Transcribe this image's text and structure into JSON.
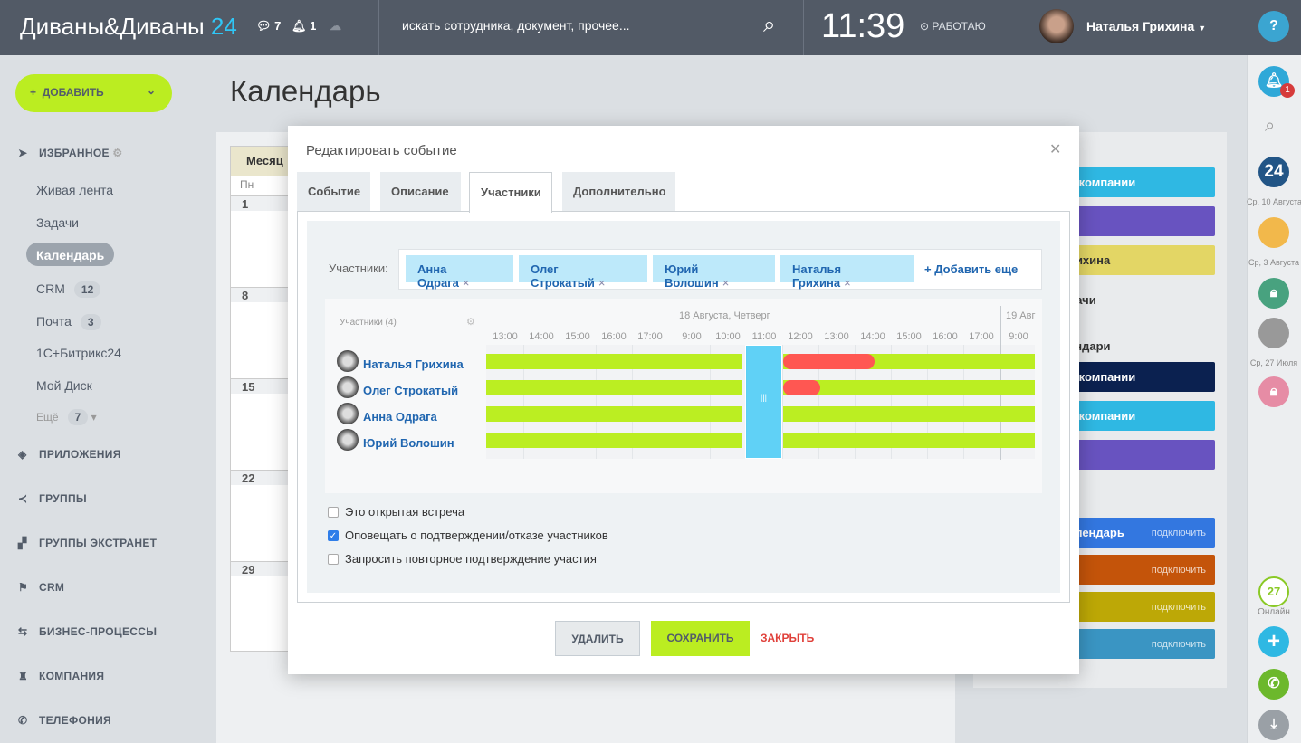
{
  "header": {
    "logo": "Диваны&Диваны",
    "logo_suffix": "24",
    "chat_count": "7",
    "notif_count": "1",
    "search_placeholder": "искать сотрудника, документ, прочее...",
    "clock": "11:39",
    "work_status": "РАБОТАЮ",
    "user_name": "Наталья Грихина"
  },
  "add_button": "ДОБАВИТЬ",
  "page_title": "Календарь",
  "sidebar": {
    "favorites": "ИЗБРАННОЕ",
    "items": [
      {
        "label": "Живая лента"
      },
      {
        "label": "Задачи"
      },
      {
        "label": "Календарь",
        "active": true
      },
      {
        "label": "CRM",
        "badge": "12"
      },
      {
        "label": "Почта",
        "badge": "3"
      },
      {
        "label": "1С+Битрикс24"
      },
      {
        "label": "Мой Диск"
      }
    ],
    "more": "Ещё",
    "more_count": "7",
    "sections": [
      {
        "label": "ПРИЛОЖЕНИЯ",
        "icon": "cube-icon"
      },
      {
        "label": "ГРУППЫ",
        "icon": "share-icon"
      },
      {
        "label": "ГРУППЫ ЭКСТРАНЕТ",
        "icon": "structure-icon"
      },
      {
        "label": "CRM",
        "icon": "flag-icon"
      },
      {
        "label": "БИЗНЕС-ПРОЦЕССЫ",
        "icon": "process-icon"
      },
      {
        "label": "КОМПАНИЯ",
        "icon": "tower-icon"
      },
      {
        "label": "ТЕЛЕФОНИЯ",
        "icon": "phone-icon"
      }
    ]
  },
  "calendar": {
    "view_tab": "Месяц",
    "weekday": "Пн",
    "weeks": [
      "1",
      "8",
      "15",
      "22",
      "29"
    ]
  },
  "right_panel": {
    "bars": [
      {
        "text": "ь компании",
        "color": "#2fb8e3"
      },
      {
        "text": "",
        "color": "#6853c0"
      },
      {
        "text": "рихина",
        "color": "#e3d665",
        "dark": true
      },
      {
        "text": "ь компании",
        "color": "#0b2150"
      },
      {
        "text": "ь компании",
        "color": "#2fb8e3"
      },
      {
        "text": "",
        "color": "#6853c0"
      }
    ],
    "texts": [
      "дачи",
      "ендари"
    ],
    "connect": [
      {
        "text": "алендарь",
        "action": "подключить",
        "color": "#3377e0"
      },
      {
        "text": "",
        "action": "подключить",
        "color": "#c4540a"
      },
      {
        "text": "",
        "action": "подключить",
        "color": "#bda806"
      },
      {
        "text": "",
        "action": "подключить",
        "color": "#3a95c3"
      }
    ]
  },
  "right_bar": {
    "help": "?",
    "notif_badge": "1",
    "recent": [
      {
        "label": "Ср, 10 Августа",
        "badge": "24"
      },
      {
        "label": "Ср, 3 Августа"
      },
      {
        "label": ""
      },
      {
        "label": "Ср, 27 Июля"
      }
    ],
    "online_count": "27",
    "online_label": "Онлайн"
  },
  "dialog": {
    "title": "Редактировать событие",
    "tabs": [
      {
        "label": "Событие"
      },
      {
        "label": "Описание"
      },
      {
        "label": "Участники",
        "active": true
      },
      {
        "label": "Дополнительно"
      }
    ],
    "attendees_label": "Участники:",
    "attendees": [
      "Анна Одрага",
      "Олег Строкатый",
      "Юрий Волошин",
      "Наталья Грихина"
    ],
    "add_more": "Добавить еще",
    "planner": {
      "header": "Участники (4)",
      "days": [
        {
          "label": "18 Августа, Четверг"
        },
        {
          "label": "19 Авг"
        }
      ],
      "hours": [
        "13:00",
        "14:00",
        "15:00",
        "16:00",
        "17:00",
        "9:00",
        "10:00",
        "11:00",
        "12:00",
        "13:00",
        "14:00",
        "15:00",
        "16:00",
        "17:00",
        "9:00"
      ],
      "selected": {
        "start": "11:00",
        "end": "12:00"
      },
      "people": [
        {
          "name": "Наталья Грихина",
          "busy": [
            {
              "start": "12:00",
              "end": "14:30"
            }
          ]
        },
        {
          "name": "Олег Строкатый",
          "busy": [
            {
              "start": "12:00",
              "end": "13:00"
            }
          ]
        },
        {
          "name": "Анна Одрага",
          "busy": []
        },
        {
          "name": "Юрий Волошин",
          "busy": []
        }
      ]
    },
    "options": [
      {
        "label": "Это открытая встреча",
        "checked": false
      },
      {
        "label": "Оповещать о подтверждении/отказе участников",
        "checked": true
      },
      {
        "label": "Запросить повторное подтверждение участия",
        "checked": false
      }
    ],
    "buttons": {
      "delete": "УДАЛИТЬ",
      "save": "СОХРАНИТЬ",
      "close": "ЗАКРЫТЬ"
    }
  },
  "colors": {
    "accent_green": "#bbed21",
    "free": "#bbee22",
    "busy": "#ff5752",
    "selection": "#2fc6f6",
    "header": "#525a66"
  }
}
